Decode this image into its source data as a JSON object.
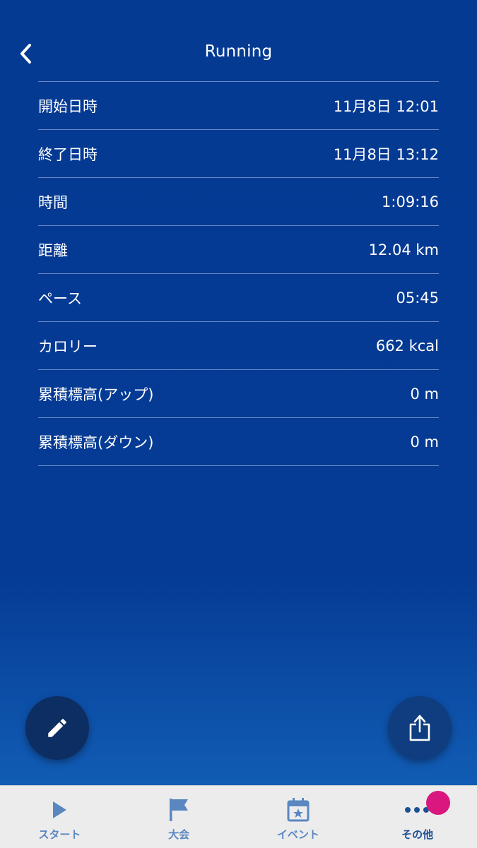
{
  "header": {
    "title": "Running"
  },
  "rows": [
    {
      "label": "開始日時",
      "value": "11月8日 12:01"
    },
    {
      "label": "終了日時",
      "value": "11月8日 13:12"
    },
    {
      "label": "時間",
      "value": "1:09:16"
    },
    {
      "label": "距離",
      "value": "12.04 km"
    },
    {
      "label": "ペース",
      "value": "05:45"
    },
    {
      "label": "カロリー",
      "value": "662 kcal"
    },
    {
      "label": "累積標高(アップ)",
      "value": "0 m"
    },
    {
      "label": "累積標高(ダウン)",
      "value": "0 m"
    }
  ],
  "tabs": [
    {
      "label": "スタート",
      "icon": "play-icon"
    },
    {
      "label": "大会",
      "icon": "flag-icon"
    },
    {
      "label": "イベント",
      "icon": "calendar-star-icon"
    },
    {
      "label": "その他",
      "icon": "more-dots-icon",
      "active": true
    }
  ],
  "colors": {
    "background": "#053a93",
    "fab_edit": "#0d2e63",
    "fab_share": "#0f3d80",
    "tab_inactive": "#5a87c0",
    "tab_active": "#1d4f93",
    "badge": "#d9177e"
  }
}
